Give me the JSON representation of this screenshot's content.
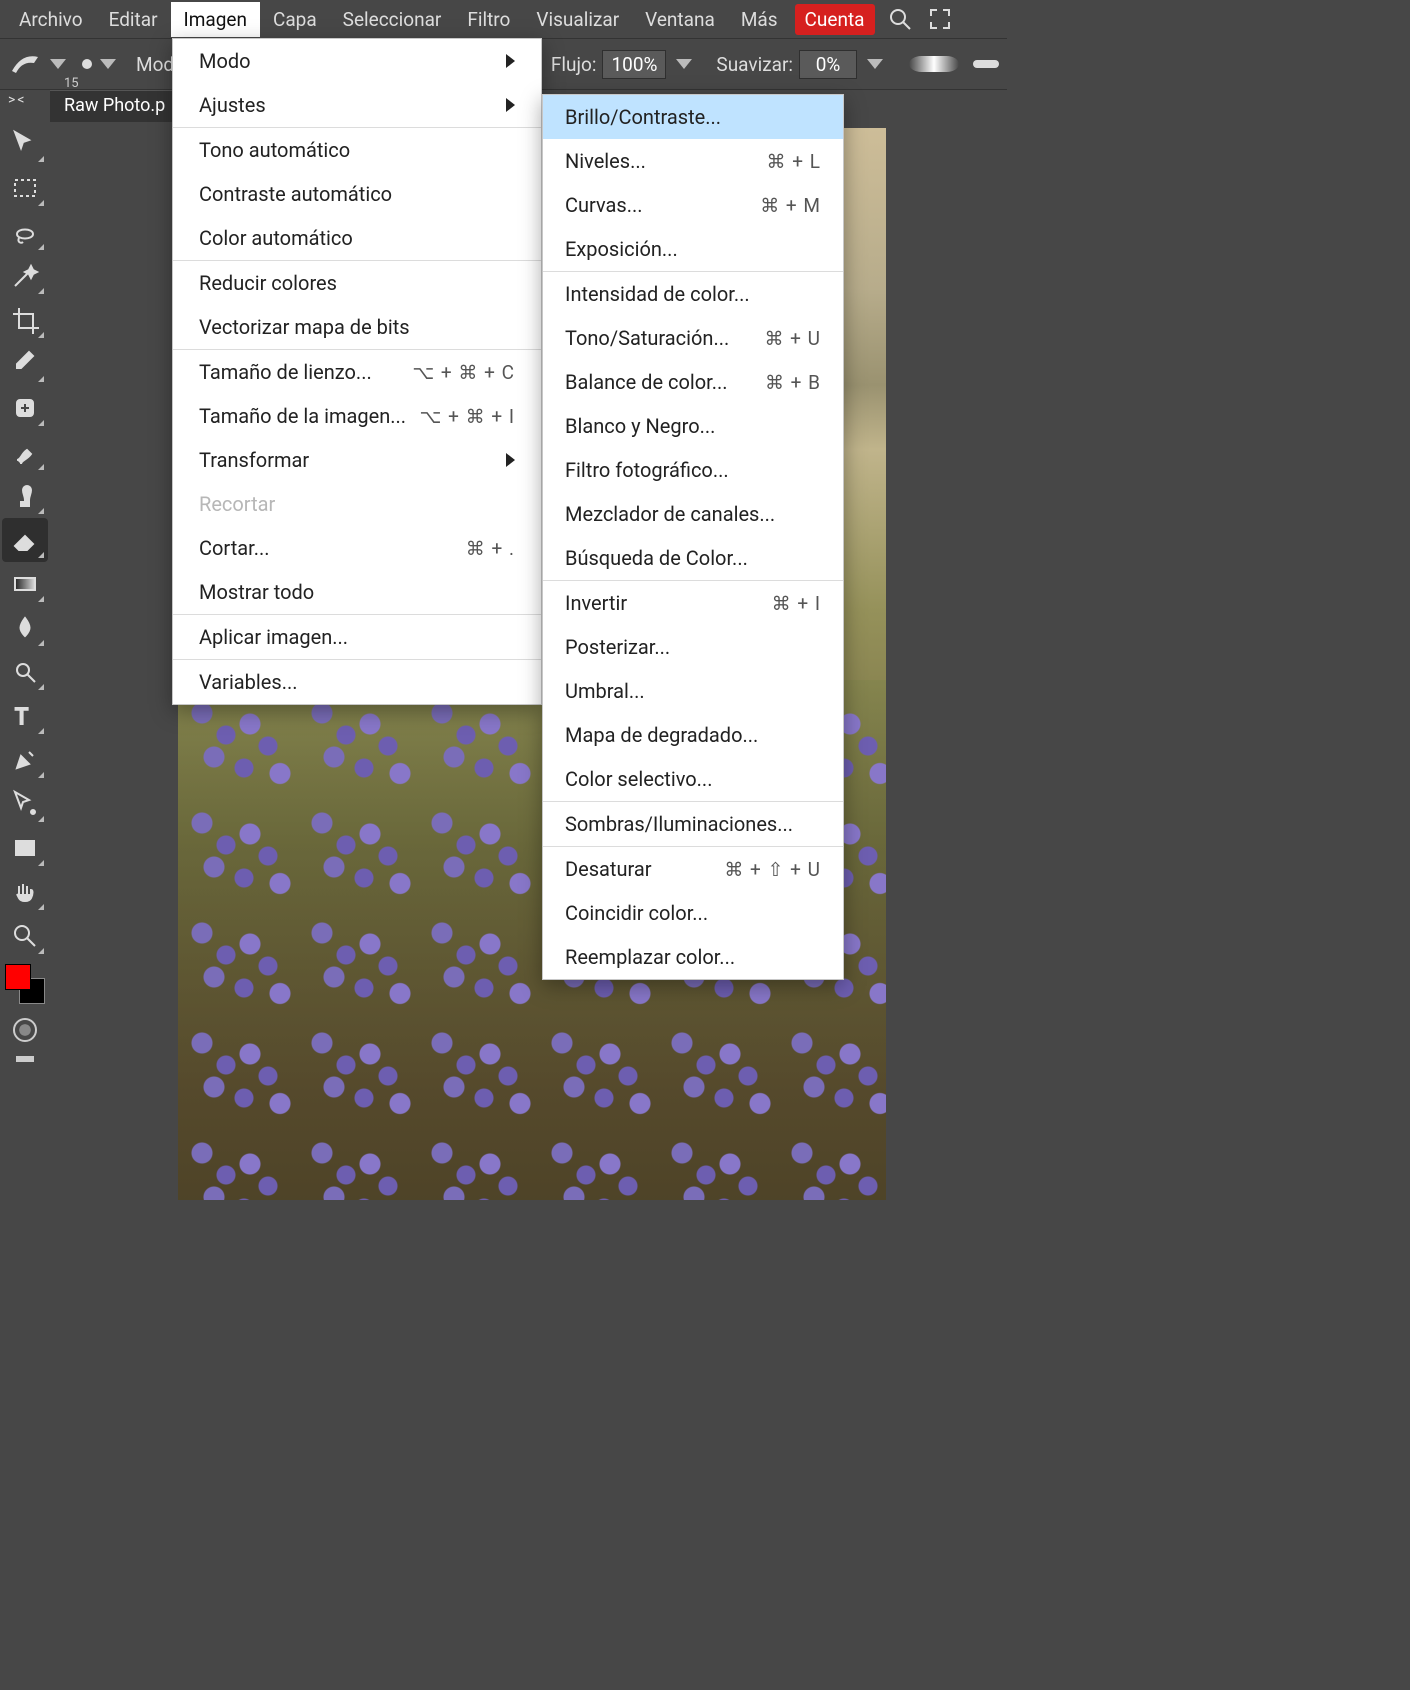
{
  "menubar": {
    "items": [
      "Archivo",
      "Editar",
      "Imagen",
      "Capa",
      "Seleccionar",
      "Filtro",
      "Visualizar",
      "Ventana",
      "Más"
    ],
    "account": "Cuenta",
    "active_index": 2
  },
  "optionbar": {
    "brush_size": "15",
    "mode_label_fragment": "Mod",
    "flujo_label": "Flujo:",
    "flujo_value": "100%",
    "suavizar_label": "Suavizar:",
    "suavizar_value": "0%"
  },
  "tab": {
    "title": "Raw Photo.p"
  },
  "ruler_toggle": "><",
  "toolbar": {
    "tools": [
      "move",
      "rect-select",
      "lasso",
      "wand",
      "crop",
      "eyedropper",
      "healing",
      "brush",
      "stamp",
      "eraser",
      "gradient",
      "blur",
      "dodge",
      "type",
      "pen",
      "path-select",
      "shape",
      "hand",
      "zoom"
    ],
    "active_index": 9,
    "fg_color": "#ff0000",
    "bg_color": "#000000"
  },
  "image_menu": {
    "groups": [
      [
        {
          "label": "Modo",
          "arrow": true
        },
        {
          "label": "Ajustes",
          "arrow": true,
          "open": true
        }
      ],
      [
        {
          "label": "Tono automático"
        },
        {
          "label": "Contraste automático"
        },
        {
          "label": "Color automático"
        }
      ],
      [
        {
          "label": "Reducir colores"
        },
        {
          "label": "Vectorizar mapa de bits"
        }
      ],
      [
        {
          "label": "Tamaño de lienzo...",
          "shortcut": "⌥ + ⌘ + C"
        },
        {
          "label": "Tamaño de la imagen...",
          "shortcut": "⌥ + ⌘ + I"
        },
        {
          "label": "Transformar",
          "arrow": true
        },
        {
          "label": "Recortar",
          "disabled": true
        },
        {
          "label": "Cortar...",
          "shortcut": "⌘ + ."
        },
        {
          "label": "Mostrar todo"
        }
      ],
      [
        {
          "label": "Aplicar imagen..."
        }
      ],
      [
        {
          "label": "Variables..."
        }
      ]
    ]
  },
  "adjust_menu": {
    "groups": [
      [
        {
          "label": "Brillo/Contraste...",
          "highlight": true
        },
        {
          "label": "Niveles...",
          "shortcut": "⌘ + L"
        },
        {
          "label": "Curvas...",
          "shortcut": "⌘ + M"
        },
        {
          "label": "Exposición..."
        }
      ],
      [
        {
          "label": "Intensidad de color..."
        },
        {
          "label": "Tono/Saturación...",
          "shortcut": "⌘ + U"
        },
        {
          "label": "Balance de color...",
          "shortcut": "⌘ + B"
        },
        {
          "label": "Blanco y Negro..."
        },
        {
          "label": "Filtro fotográfico..."
        },
        {
          "label": "Mezclador de canales..."
        },
        {
          "label": "Búsqueda de Color..."
        }
      ],
      [
        {
          "label": "Invertir",
          "shortcut": "⌘ + I"
        },
        {
          "label": "Posterizar..."
        },
        {
          "label": "Umbral..."
        },
        {
          "label": "Mapa de degradado..."
        },
        {
          "label": "Color selectivo..."
        }
      ],
      [
        {
          "label": "Sombras/Iluminaciones..."
        }
      ],
      [
        {
          "label": "Desaturar",
          "shortcut": "⌘ + ⇧ + U"
        },
        {
          "label": "Coincidir color..."
        },
        {
          "label": "Reemplazar color..."
        }
      ]
    ]
  }
}
